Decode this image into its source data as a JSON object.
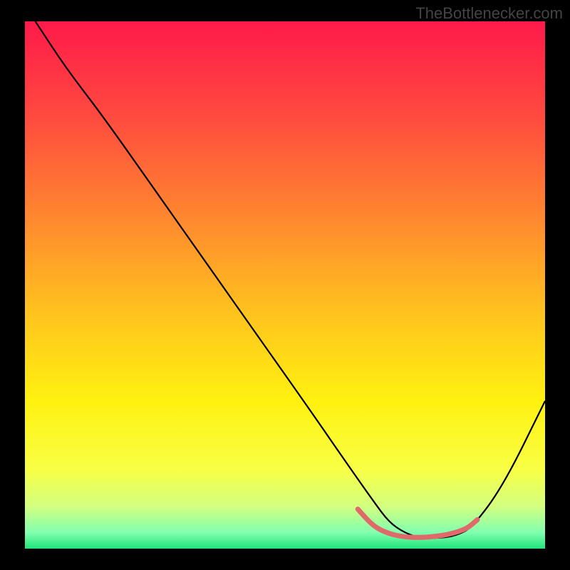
{
  "watermark": "TheBottlenecker.com",
  "chart_data": {
    "type": "line",
    "title": "",
    "xlabel": "",
    "ylabel": "",
    "xlim": [
      0,
      100
    ],
    "ylim": [
      0,
      100
    ],
    "gradient_stops": [
      {
        "offset": 0,
        "color": "#ff1a4a"
      },
      {
        "offset": 18,
        "color": "#ff4a3f"
      },
      {
        "offset": 38,
        "color": "#ff8a2e"
      },
      {
        "offset": 55,
        "color": "#ffc21e"
      },
      {
        "offset": 72,
        "color": "#fff110"
      },
      {
        "offset": 85,
        "color": "#f8ff45"
      },
      {
        "offset": 92,
        "color": "#d3ff80"
      },
      {
        "offset": 97,
        "color": "#80ffb0"
      },
      {
        "offset": 100,
        "color": "#20e47a"
      }
    ],
    "series": [
      {
        "name": "bottleneck-curve",
        "color": "#000000",
        "width": 2.2,
        "x": [
          2,
          8,
          15,
          25,
          35,
          45,
          55,
          62,
          67,
          70,
          73,
          76,
          80,
          83,
          86,
          92,
          100
        ],
        "y": [
          100,
          91,
          82,
          68,
          54,
          40,
          26,
          16,
          9,
          5,
          3,
          2,
          2,
          2.5,
          4,
          12,
          28
        ]
      },
      {
        "name": "optimal-range",
        "color": "#e06a6a",
        "width": 7,
        "x": [
          64,
          67,
          70,
          73,
          76,
          79,
          82,
          85,
          87
        ],
        "y": [
          7.5,
          4.2,
          2.8,
          2.2,
          2.1,
          2.3,
          2.8,
          3.8,
          5.5
        ]
      }
    ]
  }
}
